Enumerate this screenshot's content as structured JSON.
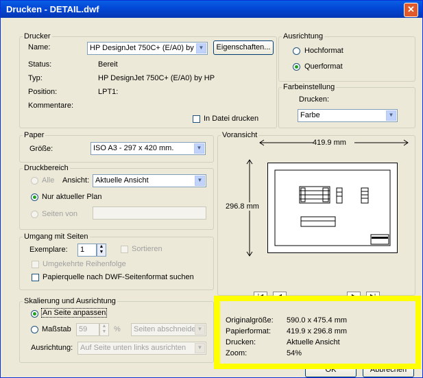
{
  "window": {
    "title": "Drucken - DETAIL.dwf",
    "close_glyph": "✕"
  },
  "printer": {
    "legend": "Drucker",
    "name_label": "Name:",
    "name_value": "HP DesignJet 750C+ (E/A0) by",
    "properties_button": "Eigenschaften...",
    "status_label": "Status:",
    "status_value": "Bereit",
    "type_label": "Typ:",
    "type_value": "HP DesignJet 750C+ (E/A0) by HP",
    "position_label": "Position:",
    "position_value": "LPT1:",
    "comment_label": "Kommentare:",
    "print_to_file": "In Datei drucken"
  },
  "orientation": {
    "legend": "Ausrichtung",
    "portrait": "Hochformat",
    "landscape": "Querformat"
  },
  "color": {
    "legend": "Farbeinstellung",
    "print_label": "Drucken:",
    "print_value": "Farbe"
  },
  "paper": {
    "legend": "Paper",
    "size_label": "Größe:",
    "size_value": "ISO A3 - 297 x 420 mm."
  },
  "print_range": {
    "legend": "Druckbereich",
    "all": "Alle",
    "view_label": "Ansicht:",
    "view_value": "Aktuelle Ansicht",
    "current_plan": "Nur aktueller Plan",
    "pages_from": "Seiten von"
  },
  "pages": {
    "legend": "Umgang mit Seiten",
    "copies_label": "Exemplare:",
    "copies_value": "1",
    "collate": "Sortieren",
    "reverse": "Umgekehrte Reihenfolge",
    "paper_source": "Papierquelle nach DWF-Seitenformat suchen"
  },
  "scaling": {
    "legend": "Skalierung und Ausrichtung",
    "fit": "An Seite anpassen",
    "scale": "Maßstab",
    "scale_value": "59",
    "percent": "%",
    "crop_value": "Seiten abschneiden",
    "align_label": "Ausrichtung:",
    "align_value": "Auf Seite unten links ausrichten"
  },
  "preview": {
    "legend": "Voransicht",
    "width_label": "419.9 mm",
    "height_label": "296.8 mm"
  },
  "info": {
    "original_label": "Originalgröße:",
    "original_value": "590.0 x 475.4 mm",
    "paper_label": "Papierformat:",
    "paper_value": "419.9 x 296.8 mm",
    "print_label": "Drucken:",
    "print_value": "Aktuelle Ansicht",
    "zoom_label": "Zoom:",
    "zoom_value": "54%"
  },
  "buttons": {
    "ok": "OK",
    "cancel": "Abbrechen"
  },
  "colors": {
    "highlight": "#ffff00",
    "titlebar": "#0a5fe3"
  }
}
